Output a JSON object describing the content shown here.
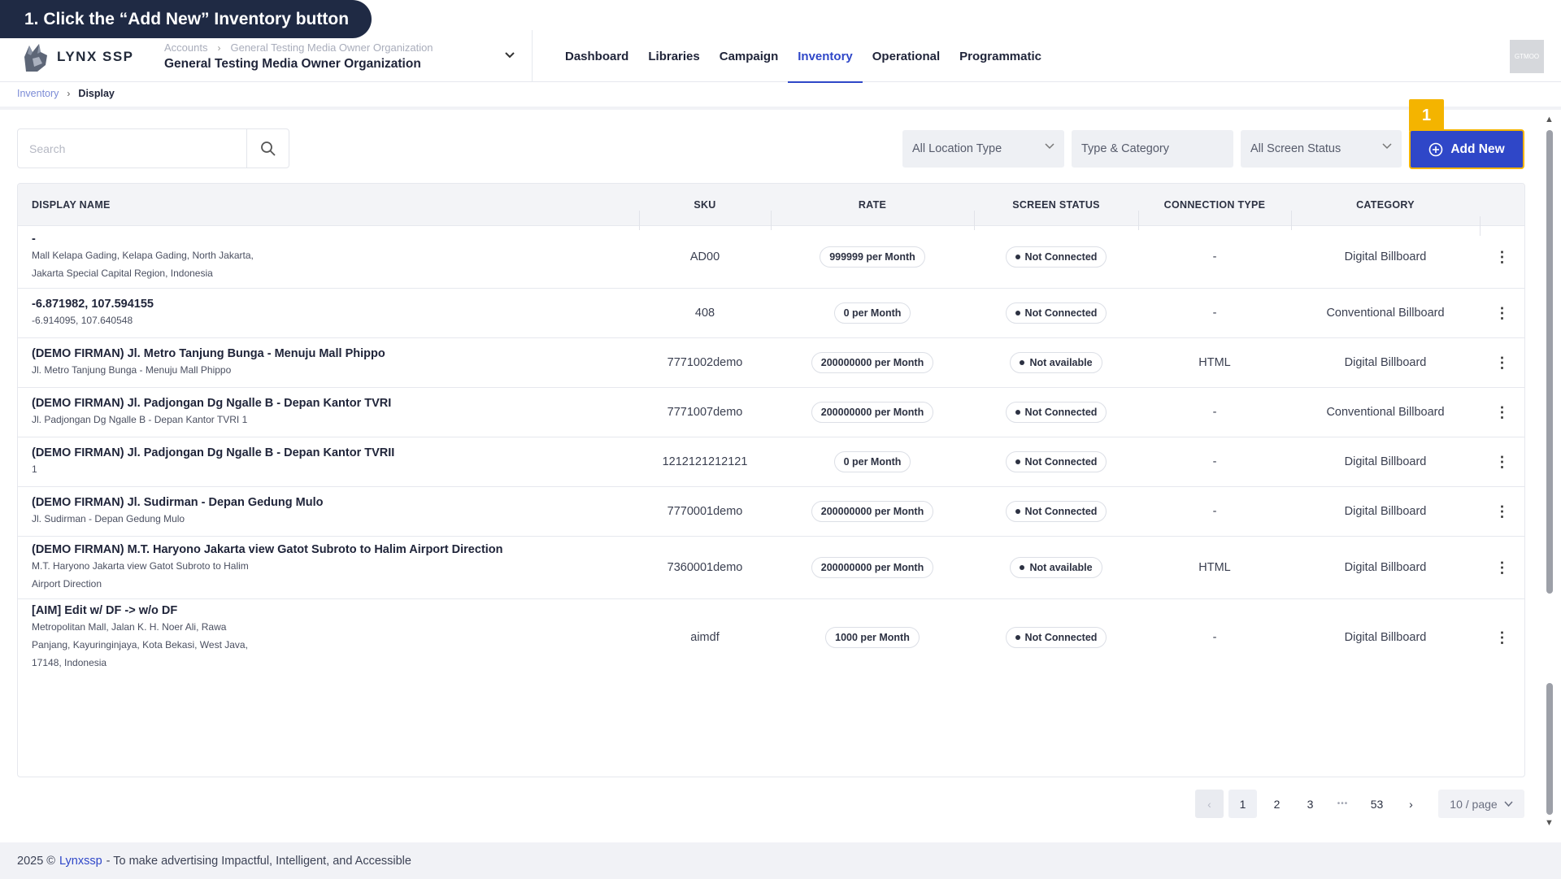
{
  "callout": {
    "text": "1. Click the “Add New” Inventory button"
  },
  "header": {
    "logo_text": "LYNX SSP",
    "org_breadcrumb": [
      "Accounts",
      "General Testing Media Owner Organization"
    ],
    "org_name": "General Testing Media Owner Organization",
    "nav": [
      "Dashboard",
      "Libraries",
      "Campaign",
      "Inventory",
      "Operational",
      "Programmatic"
    ],
    "active_nav": "Inventory",
    "avatar_text": "GTMOO"
  },
  "breadcrumb": {
    "parent": "Inventory",
    "current": "Display"
  },
  "toolbar": {
    "search_placeholder": "Search",
    "location_type": "All Location Type",
    "type_category": "Type & Category",
    "screen_status": "All Screen Status",
    "step_badge": "1",
    "add_new": "Add New"
  },
  "table": {
    "columns": [
      "DISPLAY NAME",
      "SKU",
      "RATE",
      "SCREEN STATUS",
      "CONNECTION TYPE",
      "CATEGORY"
    ],
    "rows": [
      {
        "name": "-",
        "sub": [
          "Mall Kelapa Gading, Kelapa Gading, North Jakarta,",
          "Jakarta Special Capital Region, Indonesia"
        ],
        "sku": "AD00",
        "rate": "999999 per Month",
        "status": "Not Connected",
        "conn": "-",
        "category": "Digital Billboard"
      },
      {
        "name": "-6.871982, 107.594155",
        "sub": [
          "-6.914095, 107.640548"
        ],
        "sku": "408",
        "rate": "0 per Month",
        "status": "Not Connected",
        "conn": "-",
        "category": "Conventional Billboard"
      },
      {
        "name": "(DEMO FIRMAN) Jl. Metro Tanjung Bunga - Menuju Mall Phippo",
        "sub": [
          "Jl. Metro Tanjung Bunga - Menuju Mall Phippo"
        ],
        "sku": "7771002demo",
        "rate": "200000000 per Month",
        "status": "Not available",
        "conn": "HTML",
        "category": "Digital Billboard"
      },
      {
        "name": "(DEMO FIRMAN) Jl. Padjongan Dg Ngalle B - Depan Kantor TVRI",
        "sub": [
          "Jl. Padjongan Dg Ngalle B - Depan Kantor TVRI 1"
        ],
        "sku": "7771007demo",
        "rate": "200000000 per Month",
        "status": "Not Connected",
        "conn": "-",
        "category": "Conventional Billboard"
      },
      {
        "name": "(DEMO FIRMAN) Jl. Padjongan Dg Ngalle B - Depan Kantor TVRII",
        "sub": [
          "1"
        ],
        "sku": "1212121212121",
        "rate": "0 per Month",
        "status": "Not Connected",
        "conn": "-",
        "category": "Digital Billboard"
      },
      {
        "name": "(DEMO FIRMAN) Jl. Sudirman - Depan Gedung Mulo",
        "sub": [
          "Jl. Sudirman - Depan Gedung Mulo"
        ],
        "sku": "7770001demo",
        "rate": "200000000 per Month",
        "status": "Not Connected",
        "conn": "-",
        "category": "Digital Billboard"
      },
      {
        "name": "(DEMO FIRMAN) M.T. Haryono Jakarta view Gatot Subroto to Halim Airport Direction",
        "sub": [
          "M.T. Haryono Jakarta view Gatot Subroto to Halim",
          "Airport Direction"
        ],
        "sku": "7360001demo",
        "rate": "200000000 per Month",
        "status": "Not available",
        "conn": "HTML",
        "category": "Digital Billboard"
      },
      {
        "name": "[AIM] Edit w/ DF -> w/o DF",
        "sub": [
          "Metropolitan Mall, Jalan K. H. Noer Ali, Rawa",
          "Panjang, Kayuringinjaya, Kota Bekasi, West Java,",
          "17148, Indonesia"
        ],
        "sku": "aimdf",
        "rate": "1000 per Month",
        "status": "Not Connected",
        "conn": "-",
        "category": "Digital Billboard"
      }
    ]
  },
  "pagination": {
    "pages": [
      "1",
      "2",
      "3",
      "•••",
      "53"
    ],
    "current": "1",
    "per_page": "10 / page"
  },
  "footer": {
    "prefix": "2025 ©",
    "brand": "Lynxssp",
    "suffix": "- To make advertising Impactful, Intelligent, and Accessible"
  },
  "colors": {
    "primary": "#2f47c8",
    "highlight": "#f4b400",
    "callout_bg": "#1f2a44"
  }
}
